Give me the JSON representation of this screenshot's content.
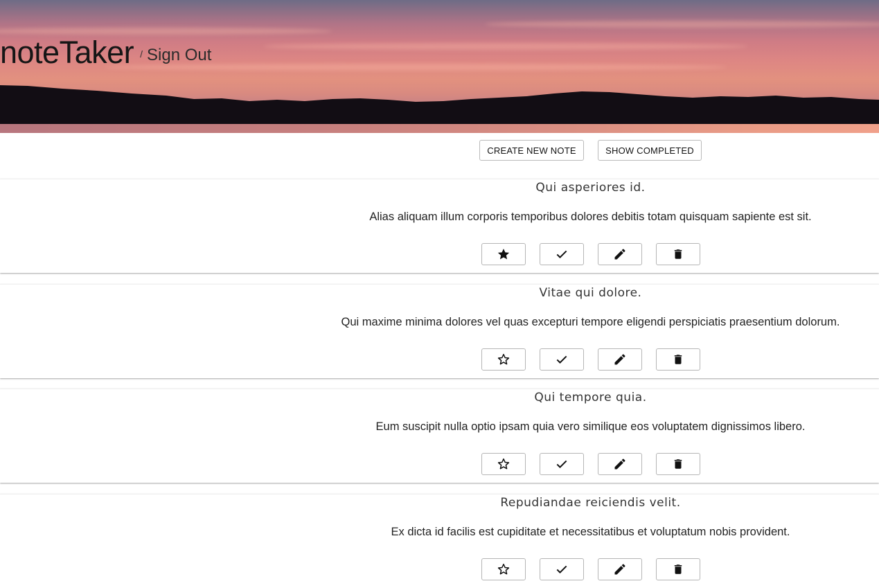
{
  "header": {
    "app_title": "noteTaker",
    "separator": "/",
    "sign_out_label": "Sign Out"
  },
  "toolbar": {
    "create_label": "CREATE NEW NOTE",
    "completed_label": "SHOW COMPLETED"
  },
  "notes": [
    {
      "title": "Qui asperiores id.",
      "body": "Alias aliquam illum corporis temporibus dolores debitis totam quisquam sapiente est sit.",
      "starred": true
    },
    {
      "title": "Vitae qui dolore.",
      "body": "Qui maxime minima dolores vel quas excepturi tempore eligendi perspiciatis praesentium dolorum.",
      "starred": false
    },
    {
      "title": "Qui tempore quia.",
      "body": "Eum suscipit nulla optio ipsam quia vero similique eos voluptatem dignissimos libero.",
      "starred": false
    },
    {
      "title": "Repudiandae reiciendis velit.",
      "body": "Ex dicta id facilis est cupiditate et necessitatibus et voluptatum nobis provident.",
      "starred": false
    }
  ],
  "note_actions": [
    "star-icon",
    "check-icon",
    "pencil-icon",
    "trash-icon"
  ],
  "colors": {
    "sky_top": "#6e6c86",
    "sky_mid": "#de8783",
    "treeline": "#120d14",
    "button_border": "#b5b5b5",
    "text": "#222222"
  }
}
